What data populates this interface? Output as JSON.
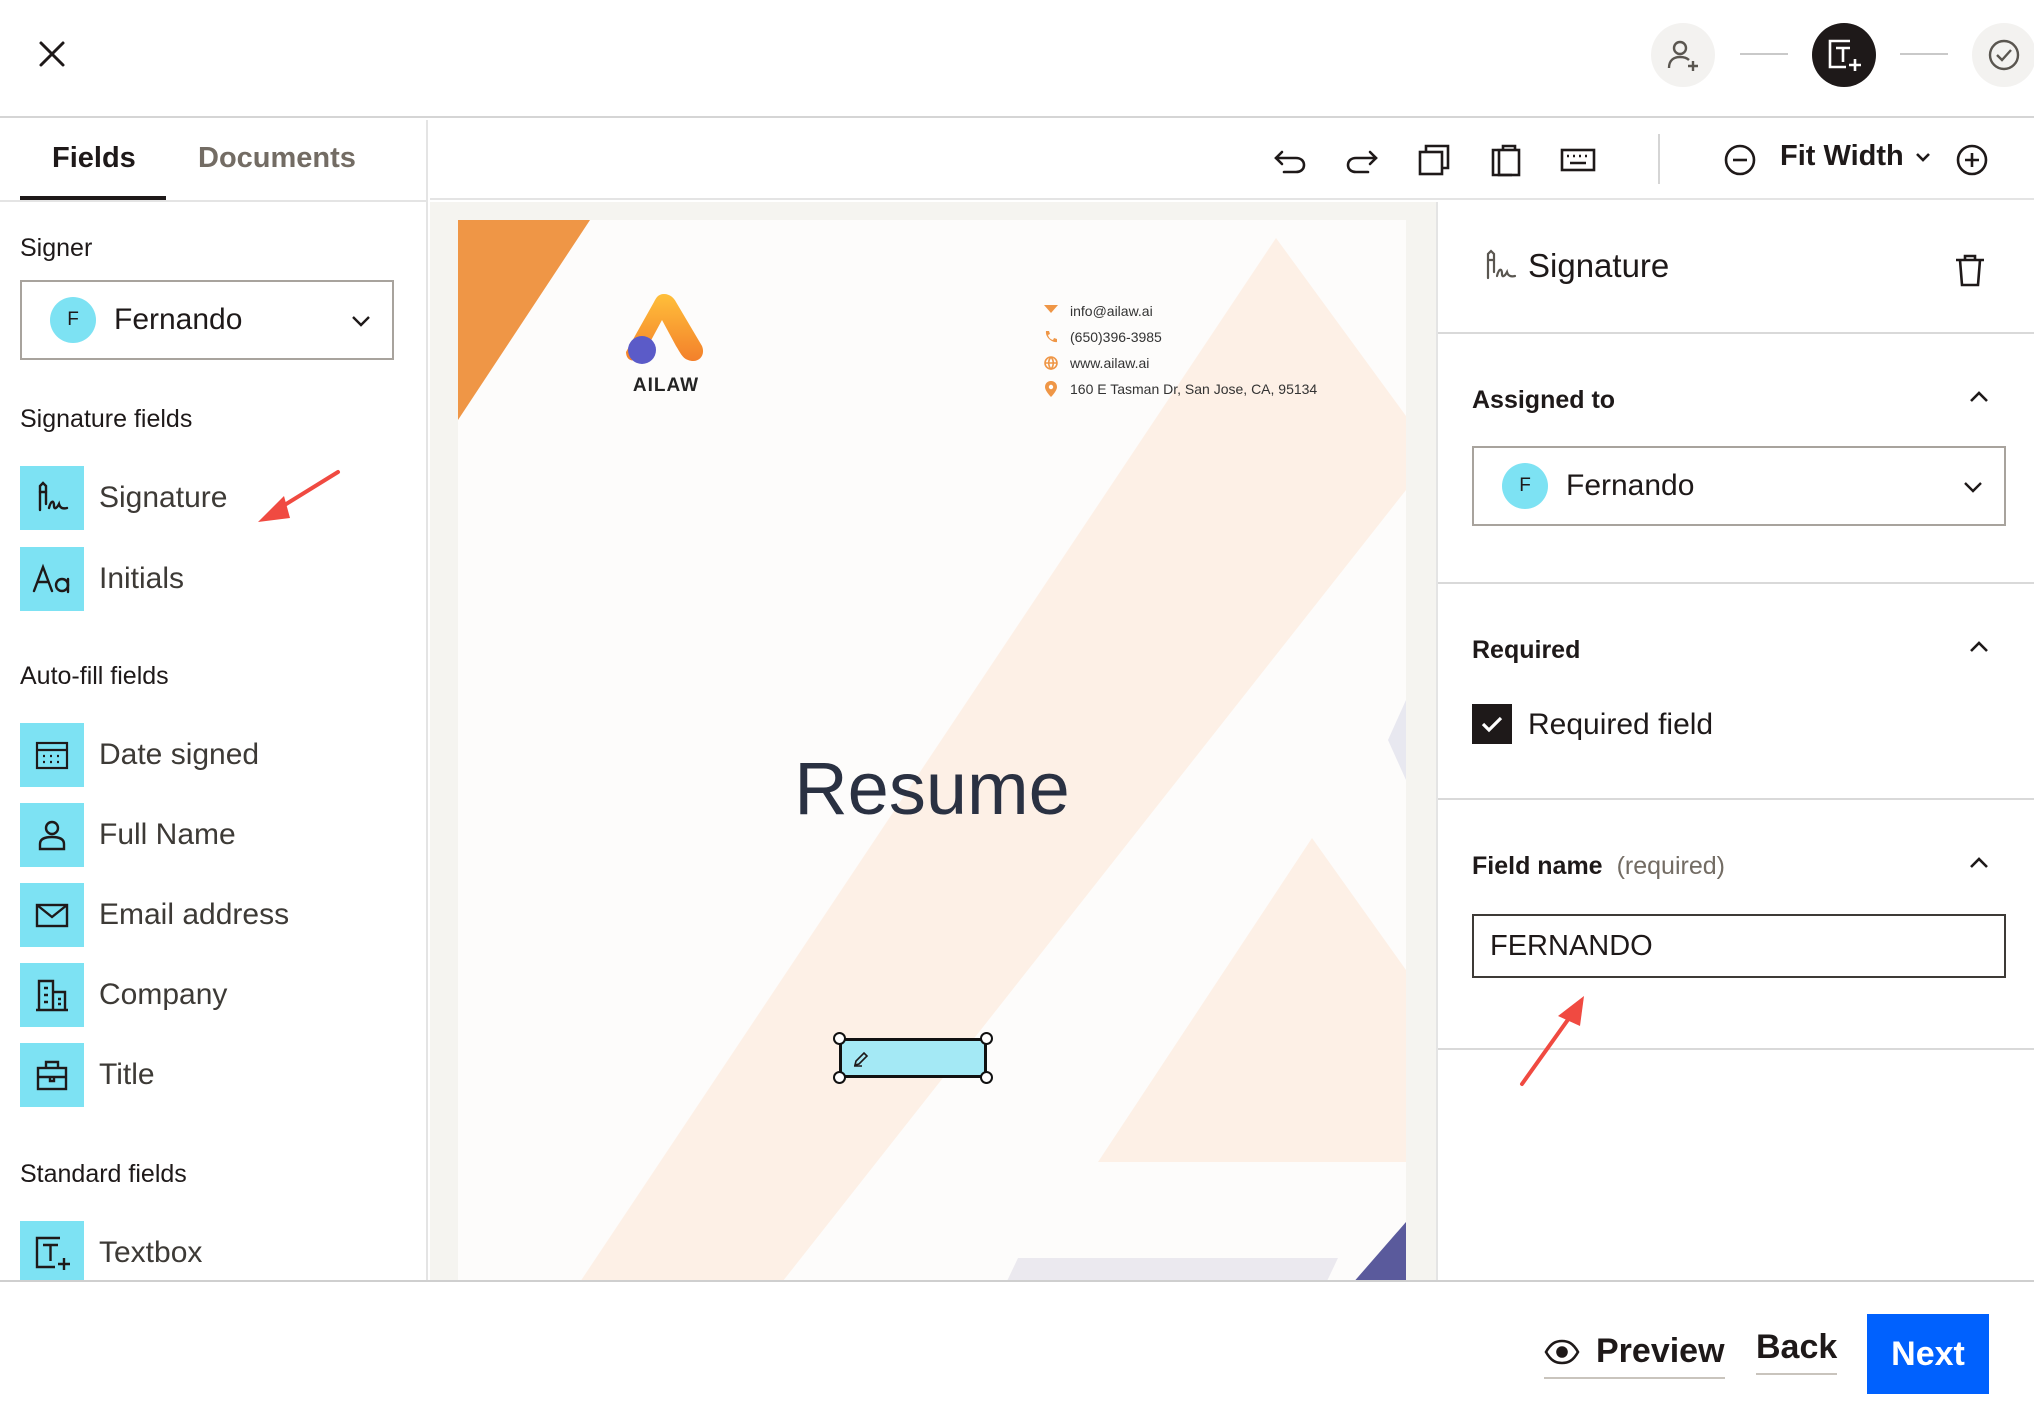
{
  "header": {
    "close_icon": "close-icon",
    "steps": [
      {
        "name": "add-signer-step",
        "icon": "person-add-icon",
        "active": false
      },
      {
        "name": "add-fields-step",
        "icon": "textbox-add-icon",
        "active": true
      },
      {
        "name": "review-step",
        "icon": "check-circle-icon",
        "active": false
      }
    ]
  },
  "sidebar": {
    "tabs": [
      {
        "label": "Fields",
        "active": true
      },
      {
        "label": "Documents",
        "active": false
      }
    ],
    "signer_label": "Signer",
    "signer": {
      "initial": "F",
      "name": "Fernando"
    },
    "signature_fields": {
      "label": "Signature fields",
      "items": [
        {
          "label": "Signature",
          "icon": "signature-icon"
        },
        {
          "label": "Initials",
          "icon": "initials-icon"
        }
      ]
    },
    "autofill_fields": {
      "label": "Auto-fill fields",
      "items": [
        {
          "label": "Date signed",
          "icon": "calendar-icon"
        },
        {
          "label": "Full Name",
          "icon": "person-icon"
        },
        {
          "label": "Email address",
          "icon": "mail-icon"
        },
        {
          "label": "Company",
          "icon": "building-icon"
        },
        {
          "label": "Title",
          "icon": "briefcase-icon"
        }
      ]
    },
    "standard_fields": {
      "label": "Standard fields",
      "items": [
        {
          "label": "Textbox",
          "icon": "textbox-icon"
        }
      ]
    }
  },
  "toolbar": {
    "tools": [
      "undo-icon",
      "redo-icon",
      "copy-icon",
      "paste-icon",
      "keyboard-icon"
    ],
    "zoom_label": "Fit Width"
  },
  "document": {
    "logo_text": "AILAW",
    "contact": {
      "email": "info@ailaw.ai",
      "phone": "(650)396-3985",
      "website": "www.ailaw.ai",
      "address": "160 E Tasman Dr, San Jose, CA, 95134"
    },
    "title": "Resume",
    "placed_field_icon": "pen-icon"
  },
  "properties": {
    "title": "Signature",
    "assigned_to_label": "Assigned to",
    "assignee": {
      "initial": "F",
      "name": "Fernando"
    },
    "required_label": "Required",
    "required_field_label": "Required field",
    "required_checked": true,
    "field_name_label": "Field name",
    "field_name_hint": "(required)",
    "field_name_value": "FERNANDO"
  },
  "footer": {
    "preview_label": "Preview",
    "back_label": "Back",
    "next_label": "Next"
  },
  "colors": {
    "accent": "#0061fe",
    "field_fill": "#7de2f3",
    "annotation_arrow": "#f04a41",
    "dark": "#1e1919"
  }
}
